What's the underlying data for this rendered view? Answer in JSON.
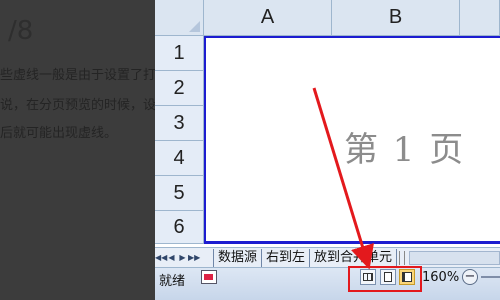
{
  "background_doc": {
    "number": "/8",
    "lines": [
      "些虚线一般是由于设置了打",
      "说，在分页预览的时候，设",
      "后就可能出现虚线。"
    ]
  },
  "columns": [
    "A",
    "B"
  ],
  "rows": [
    "1",
    "2",
    "3",
    "4",
    "5",
    "6"
  ],
  "page_watermark": "第 1 页",
  "sheet_tabs": [
    "数据源",
    "右到左",
    "放到合并单元"
  ],
  "status": {
    "ready_text": "就绪",
    "zoom": "160%",
    "zoom_out": "−"
  },
  "colors": {
    "annotation": "#e3191d",
    "page_border": "#1c1cd0",
    "header_bg": "#dbe5f1"
  }
}
